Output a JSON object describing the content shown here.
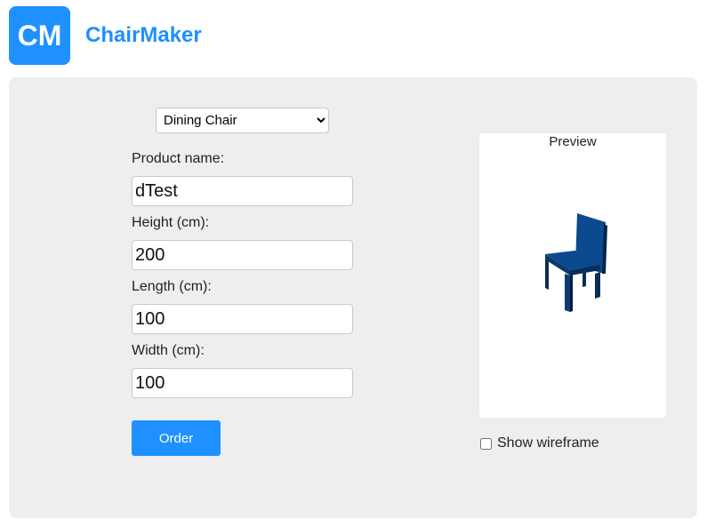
{
  "header": {
    "logo_text": "CM",
    "app_name": "ChairMaker"
  },
  "form": {
    "type_select": {
      "selected": "Dining Chair"
    },
    "product_name": {
      "label": "Product name:",
      "value": "dTest"
    },
    "height": {
      "label": "Height (cm):",
      "value": "200"
    },
    "length": {
      "label": "Length (cm):",
      "value": "100"
    },
    "width": {
      "label": "Width (cm):",
      "value": "100"
    },
    "order_label": "Order"
  },
  "preview": {
    "title": "Preview",
    "chair_color": "#0b4a8f",
    "wireframe_label": "Show wireframe",
    "wireframe_checked": false
  },
  "colors": {
    "accent": "#1e90ff",
    "panel_bg": "#eeeeee"
  }
}
